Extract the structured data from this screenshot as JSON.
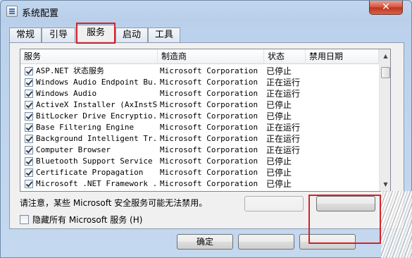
{
  "window": {
    "title": "系统配置",
    "close_glyph": "✕"
  },
  "tabs": [
    {
      "label": "常规"
    },
    {
      "label": "引导"
    },
    {
      "label": "服务",
      "active": true
    },
    {
      "label": "启动"
    },
    {
      "label": "工具"
    }
  ],
  "services": {
    "columns": {
      "name": "服务",
      "maker": "制造商",
      "status": "状态",
      "disabled_date": "禁用日期"
    },
    "rows": [
      {
        "name": "ASP.NET 状态服务",
        "maker": "Microsoft Corporation",
        "status": "已停止",
        "date": "",
        "checked": true
      },
      {
        "name": "Windows Audio Endpoint Bu...",
        "maker": "Microsoft Corporation",
        "status": "正在运行",
        "date": "",
        "checked": true
      },
      {
        "name": "Windows Audio",
        "maker": "Microsoft Corporation",
        "status": "正在运行",
        "date": "",
        "checked": true
      },
      {
        "name": "ActiveX Installer (AxInstSV)",
        "maker": "Microsoft Corporation",
        "status": "已停止",
        "date": "",
        "checked": true
      },
      {
        "name": "BitLocker Drive Encryptio...",
        "maker": "Microsoft Corporation",
        "status": "已停止",
        "date": "",
        "checked": true
      },
      {
        "name": "Base Filtering Engine",
        "maker": "Microsoft Corporation",
        "status": "正在运行",
        "date": "",
        "checked": true
      },
      {
        "name": "Background Intelligent Tr...",
        "maker": "Microsoft Corporation",
        "status": "正在运行",
        "date": "",
        "checked": true
      },
      {
        "name": "Computer Browser",
        "maker": "Microsoft Corporation",
        "status": "正在运行",
        "date": "",
        "checked": true
      },
      {
        "name": "Bluetooth Support Service",
        "maker": "Microsoft Corporation",
        "status": "已停止",
        "date": "",
        "checked": true
      },
      {
        "name": "Certificate Propagation",
        "maker": "Microsoft Corporation",
        "status": "已停止",
        "date": "",
        "checked": true
      },
      {
        "name": "Microsoft .NET Framework ...",
        "maker": "Microsoft Corporation",
        "status": "已停止",
        "date": "",
        "checked": true
      }
    ]
  },
  "note": "请注意，某些 Microsoft 安全服务可能无法禁用。",
  "hide_ms": {
    "label": "隐藏所有 Microsoft 服务 (H)",
    "checked": false
  },
  "buttons": {
    "ok": "确定"
  },
  "icons": {
    "app": "system-config-icon",
    "check": "checkmark-icon",
    "up": "scroll-up-arrow-icon",
    "down": "scroll-down-arrow-icon"
  }
}
